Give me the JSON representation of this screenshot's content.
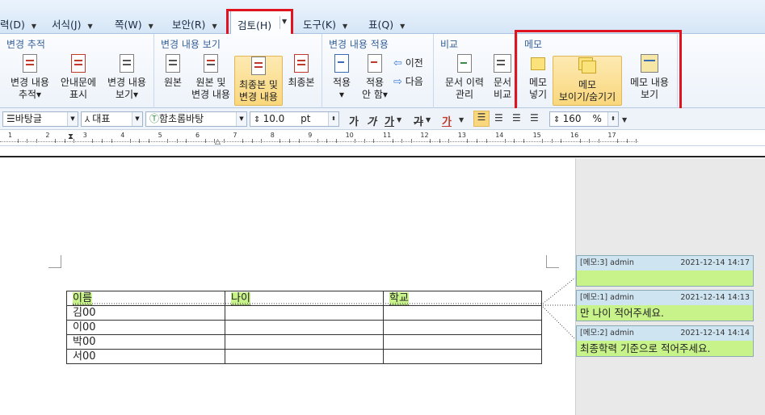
{
  "menu": {
    "items": [
      {
        "label": "력(D)"
      },
      {
        "label": "서식(J)"
      },
      {
        "label": "쪽(W)"
      },
      {
        "label": "보안(R)"
      },
      {
        "label": "검토(H)"
      },
      {
        "label": "도구(K)"
      },
      {
        "label": "표(Q)"
      }
    ]
  },
  "ribbon": {
    "groups": [
      {
        "title": "변경 추적",
        "buttons": [
          {
            "label1": "변경 내용",
            "label2": "추적▾"
          },
          {
            "label1": "안내문에",
            "label2": "표시"
          },
          {
            "label1": "변경 내용",
            "label2": "보기▾"
          }
        ]
      },
      {
        "title": "변경 내용 보기",
        "buttons": [
          {
            "label1": "원본",
            "label2": ""
          },
          {
            "label1": "원본 및",
            "label2": "변경 내용"
          },
          {
            "label1": "최종본 및",
            "label2": "변경 내용"
          },
          {
            "label1": "최종본",
            "label2": ""
          }
        ]
      },
      {
        "title": "변경 내용 적용",
        "buttons": [
          {
            "label1": "적용",
            "label2": "▾"
          },
          {
            "label1": "적용",
            "label2": "안 함▾"
          }
        ],
        "small": [
          {
            "label": "이전"
          },
          {
            "label": "다음"
          }
        ]
      },
      {
        "title": "비교",
        "buttons": [
          {
            "label1": "문서 이력",
            "label2": "관리"
          },
          {
            "label1": "문서",
            "label2": "비교"
          }
        ]
      },
      {
        "title": "메모",
        "buttons": [
          {
            "label1": "메모",
            "label2": "넣기"
          },
          {
            "label1": "메모",
            "label2": "보이기/숨기기"
          },
          {
            "label1": "메모 내용",
            "label2": "보기"
          }
        ]
      }
    ]
  },
  "format": {
    "style": "바탕글",
    "lang": "대표",
    "font": "함초롬바탕",
    "size": "10.0",
    "unit": "pt",
    "zoom": "160",
    "zoom_unit": "%",
    "bold": "가",
    "italic": "가",
    "underline": "가",
    "strike": "가",
    "color_text": "가"
  },
  "ruler": {
    "numbers": [
      "1",
      "2",
      "3",
      "4",
      "5",
      "6",
      "7",
      "8",
      "9",
      "10",
      "11",
      "12",
      "13",
      "14",
      "15",
      "16",
      "17"
    ]
  },
  "table": {
    "headers": [
      "이름",
      "나이",
      "학교"
    ],
    "rows": [
      [
        "김00",
        "",
        ""
      ],
      [
        "이00",
        "",
        ""
      ],
      [
        "박00",
        "",
        ""
      ],
      [
        "서00",
        "",
        ""
      ]
    ]
  },
  "memos": [
    {
      "id": "[메모:3] admin",
      "date": "2021-12-14 14:17",
      "text": ""
    },
    {
      "id": "[메모:1] admin",
      "date": "2021-12-14 14:13",
      "text": "만 나이 적어주세요."
    },
    {
      "id": "[메모:2] admin",
      "date": "2021-12-14 14:14",
      "text": "최종학력 기준으로 적어주세요."
    }
  ],
  "colors": {
    "highlight_box": "#e0141e",
    "memo_body": "#c8f28a",
    "memo_header": "#cfe4f1"
  }
}
